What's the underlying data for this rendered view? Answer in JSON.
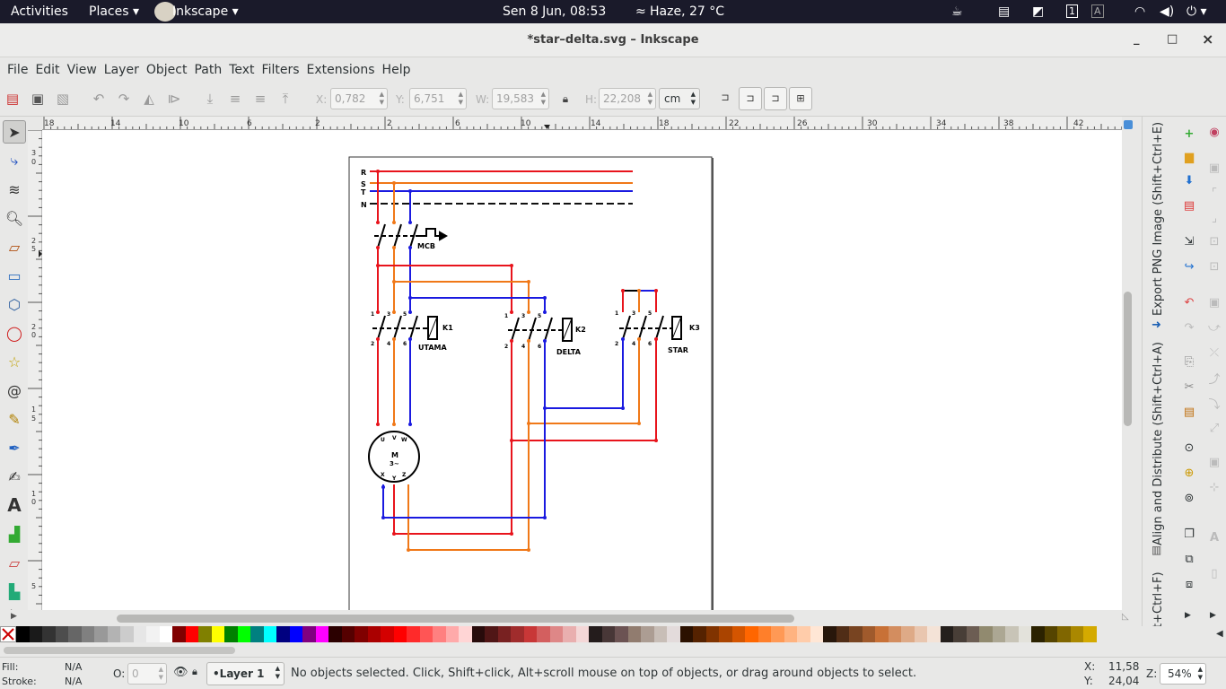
{
  "topbar": {
    "activities": "Activities",
    "places": "Places",
    "app": "Inkscape",
    "datetime": "Sen  8 Jun, 08:53",
    "weather": "Haze, 27 °C"
  },
  "window": {
    "title": "*star–delta.svg – Inkscape",
    "minimize": "_",
    "maximize": "□",
    "close": "×"
  },
  "menu": [
    "File",
    "Edit",
    "View",
    "Layer",
    "Object",
    "Path",
    "Text",
    "Filters",
    "Extensions",
    "Help"
  ],
  "toolbar": {
    "x_label": "X:",
    "x_value": "0,782",
    "y_label": "Y:",
    "y_value": "6,751",
    "w_label": "W:",
    "w_value": "19,583",
    "h_label": "H:",
    "h_value": "22,208",
    "unit": "cm"
  },
  "hruler_ticks": [
    "18",
    "14",
    "10",
    "6",
    "2",
    "2",
    "6",
    "10",
    "14",
    "18",
    "22",
    "26",
    "30",
    "34",
    "38",
    "42"
  ],
  "vruler_ticks": [
    "3",
    "0",
    "2",
    "5",
    "2",
    "0",
    "1",
    "5",
    "1",
    "0",
    "5"
  ],
  "dock": {
    "export_png": "Export PNG Image (Shift+Ctrl+E)",
    "align_distribute": "Align and Distribute (Shift+Ctrl+A)",
    "fill_stroke": "t+Ctrl+F)"
  },
  "drawing": {
    "phases": [
      "R",
      "S",
      "T",
      "N"
    ],
    "mcb": "MCB",
    "k1": "K1",
    "k1_name": "UTAMA",
    "k2": "K2",
    "k2_name": "DELTA",
    "k3": "K3",
    "k3_name": "STAR",
    "motor": "M",
    "motor_type": "3~",
    "terminals_top": [
      "U",
      "V",
      "W"
    ],
    "terminals_bottom": [
      "X",
      "Y",
      "Z"
    ],
    "contact_top": [
      "1",
      "3",
      "5"
    ],
    "contact_bottom": [
      "2",
      "4",
      "6"
    ]
  },
  "colors": {
    "phase_r": "#e8141c",
    "phase_s": "#f07818",
    "phase_t": "#1a1ae0",
    "neutral": "#111111"
  },
  "palette": [
    "#000000",
    "#1a1a1a",
    "#333333",
    "#4d4d4d",
    "#666666",
    "#808080",
    "#999999",
    "#b3b3b3",
    "#cccccc",
    "#e6e6e6",
    "#f2f2f2",
    "#ffffff",
    "#800000",
    "#ff0000",
    "#808000",
    "#ffff00",
    "#008000",
    "#00ff00",
    "#008080",
    "#00ffff",
    "#000080",
    "#0000ff",
    "#800080",
    "#ff00ff",
    "#2b0000",
    "#550000",
    "#800000",
    "#aa0000",
    "#d40000",
    "#ff0000",
    "#ff2a2a",
    "#ff5555",
    "#ff8080",
    "#ffaaaa",
    "#ffd5d5",
    "#280b0b",
    "#501616",
    "#782121",
    "#a02c2c",
    "#c83737",
    "#d35f5f",
    "#de8787",
    "#e9afaf",
    "#f4d7d7",
    "#241c1c",
    "#483737",
    "#6c5353",
    "#917c6f",
    "#ac9d93",
    "#c8beb7",
    "#e3dbdb",
    "#2b1100",
    "#552200",
    "#803300",
    "#aa4400",
    "#d45500",
    "#ff6600",
    "#ff7f2a",
    "#ff9955",
    "#ffb380",
    "#ffccaa",
    "#ffe6d5",
    "#28170b",
    "#502d16",
    "#784421",
    "#a05a2c",
    "#c87137",
    "#d38d5f",
    "#deaa87",
    "#e9c6af",
    "#f4e3d7",
    "#241f1c",
    "#483e37",
    "#6c5d53",
    "#918a6f",
    "#aca793",
    "#c8c4b7",
    "#e3e2db",
    "#2b2200",
    "#554400",
    "#806600",
    "#aa8800",
    "#d4aa00"
  ],
  "status": {
    "fill_label": "Fill:",
    "fill_value": "N/A",
    "stroke_label": "Stroke:",
    "stroke_value": "N/A",
    "opacity_label": "O:",
    "opacity_value": "0",
    "layer": "•Layer 1",
    "message": "No objects selected. Click, Shift+click, Alt+scroll mouse on top of objects, or drag around objects to select.",
    "x_label": "X:",
    "x_value": "11,58",
    "y_label": "Y:",
    "y_value": "24,04",
    "zoom_label": "Z:",
    "zoom_value": "54%"
  }
}
